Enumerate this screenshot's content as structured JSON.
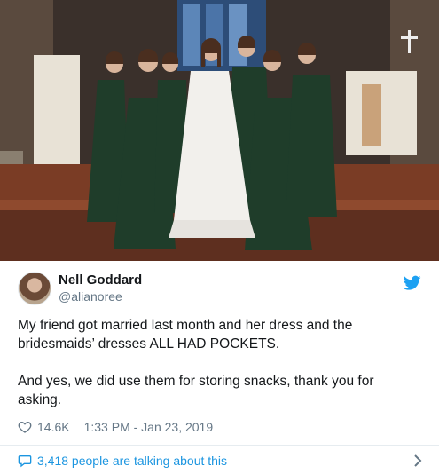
{
  "tweet": {
    "display_name": "Nell Goddard",
    "handle": "@alianoree",
    "text": "My friend got married last month and her dress and the bridesmaids’ dresses ALL HAD POCKETS.\n\nAnd yes, we did use them for storing snacks, thank you for asking.",
    "likes": "14.6K",
    "timestamp": "1:33 PM - Jan 23, 2019",
    "conversation": "3,418 people are talking about this"
  },
  "icons": {
    "brand": "twitter-bird-icon",
    "like": "heart-icon",
    "reply": "speech-bubble-icon",
    "more": "chevron-right-icon"
  },
  "colors": {
    "link": "#1b95e0",
    "secondary_text": "#657786",
    "dress_green": "#1f3d2a",
    "divider": "#e6ecf0"
  }
}
